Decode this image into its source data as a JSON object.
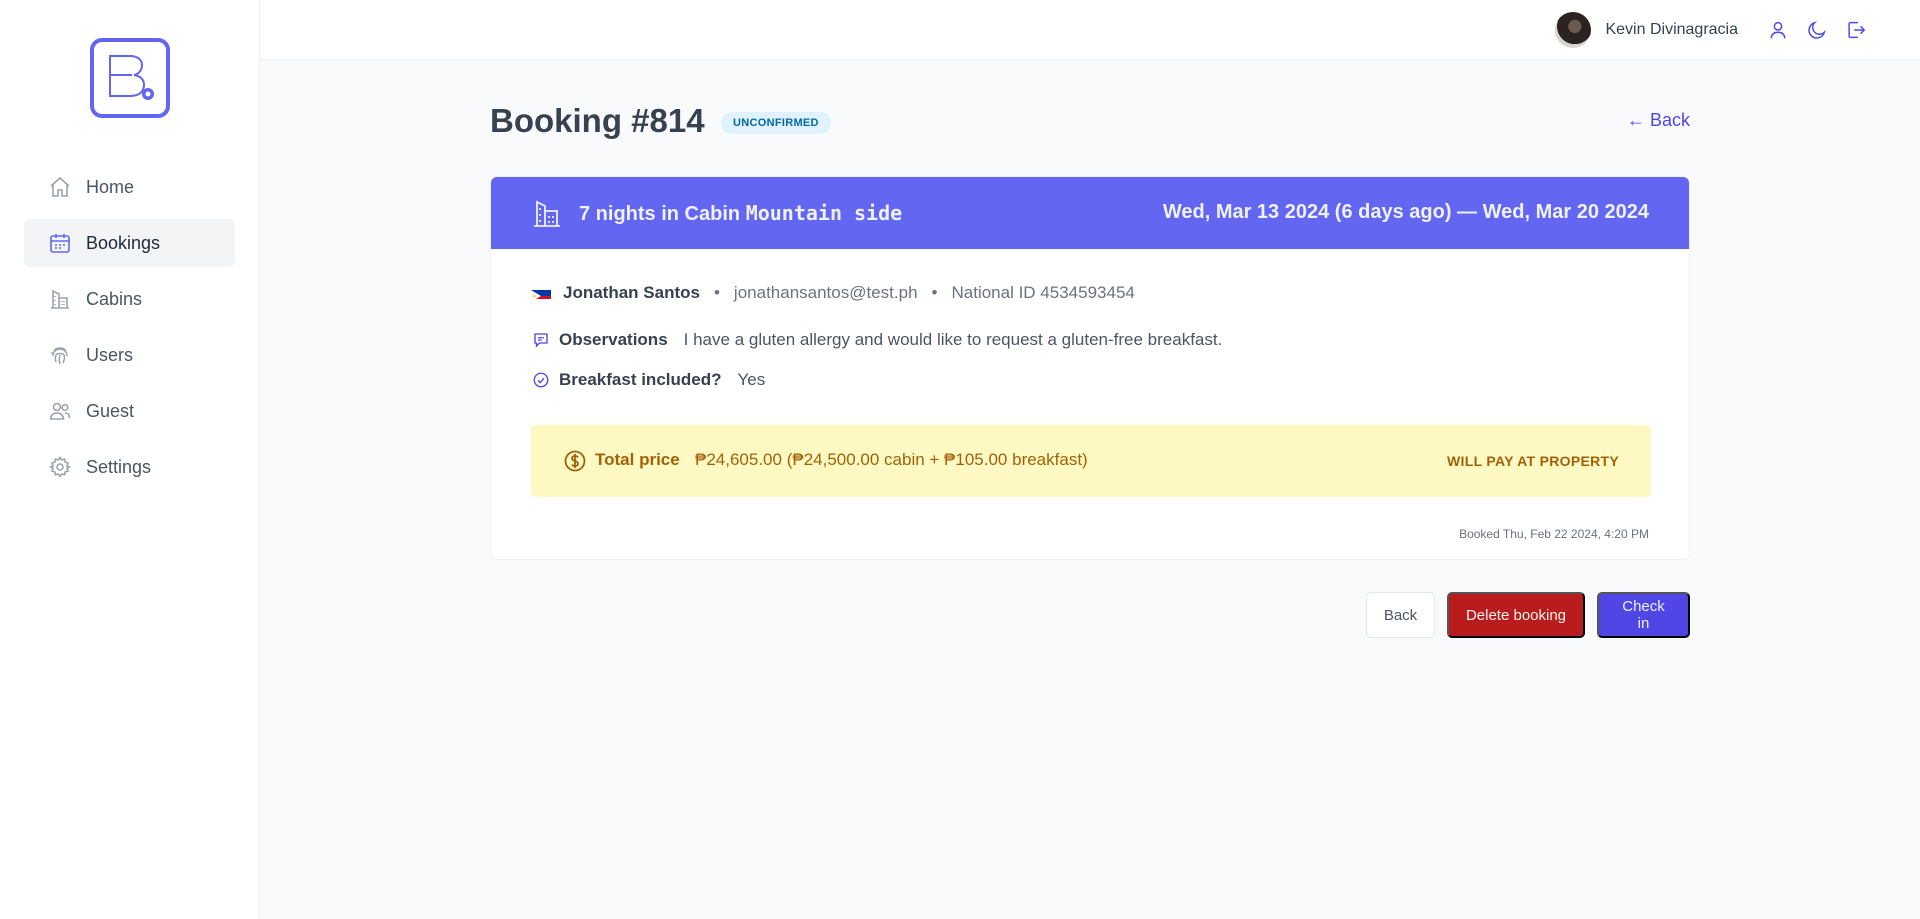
{
  "sidebar": {
    "items": [
      {
        "label": "Home",
        "icon": "home-icon"
      },
      {
        "label": "Bookings",
        "icon": "calendar-icon"
      },
      {
        "label": "Cabins",
        "icon": "cabin-icon"
      },
      {
        "label": "Users",
        "icon": "fingerprint-icon"
      },
      {
        "label": "Guest",
        "icon": "users-icon"
      },
      {
        "label": "Settings",
        "icon": "gear-icon"
      }
    ],
    "active": "Bookings"
  },
  "header": {
    "user_name": "Kevin Divinagracia",
    "icons": [
      "user-icon",
      "moon-icon",
      "logout-icon"
    ]
  },
  "booking": {
    "title": "Booking #814",
    "status": "UNCONFIRMED",
    "back_link": "← Back",
    "stay_prefix": "7 nights in Cabin",
    "cabin_name": "Mountain side",
    "dates": "Wed, Mar 13 2024 (6 days ago) — Wed, Mar 20 2024",
    "guest": {
      "name": "Jonathan Santos",
      "separator": "•",
      "email": "jonathansantos@test.ph",
      "national_id": "National ID 4534593454"
    },
    "observations_label": "Observations",
    "observations": "I have a gluten allergy and would like to request a gluten-free breakfast.",
    "breakfast_label": "Breakfast included?",
    "breakfast_value": "Yes",
    "total_label": "Total price",
    "total_value": "₱24,605.00 (₱24,500.00 cabin + ₱105.00 breakfast)",
    "payment_status": "WILL PAY AT PROPERTY",
    "booked_at": "Booked Thu, Feb 22 2024, 4:20 PM"
  },
  "actions": {
    "back": "Back",
    "delete": "Delete booking",
    "check_in": "Check in"
  },
  "colors": {
    "brand": "#6366f1",
    "primary_button": "#4f46e5",
    "danger_button": "#b91c1c",
    "badge_bg": "#e0f2fe",
    "price_bg": "#fef9c3",
    "price_text": "#a16207"
  }
}
